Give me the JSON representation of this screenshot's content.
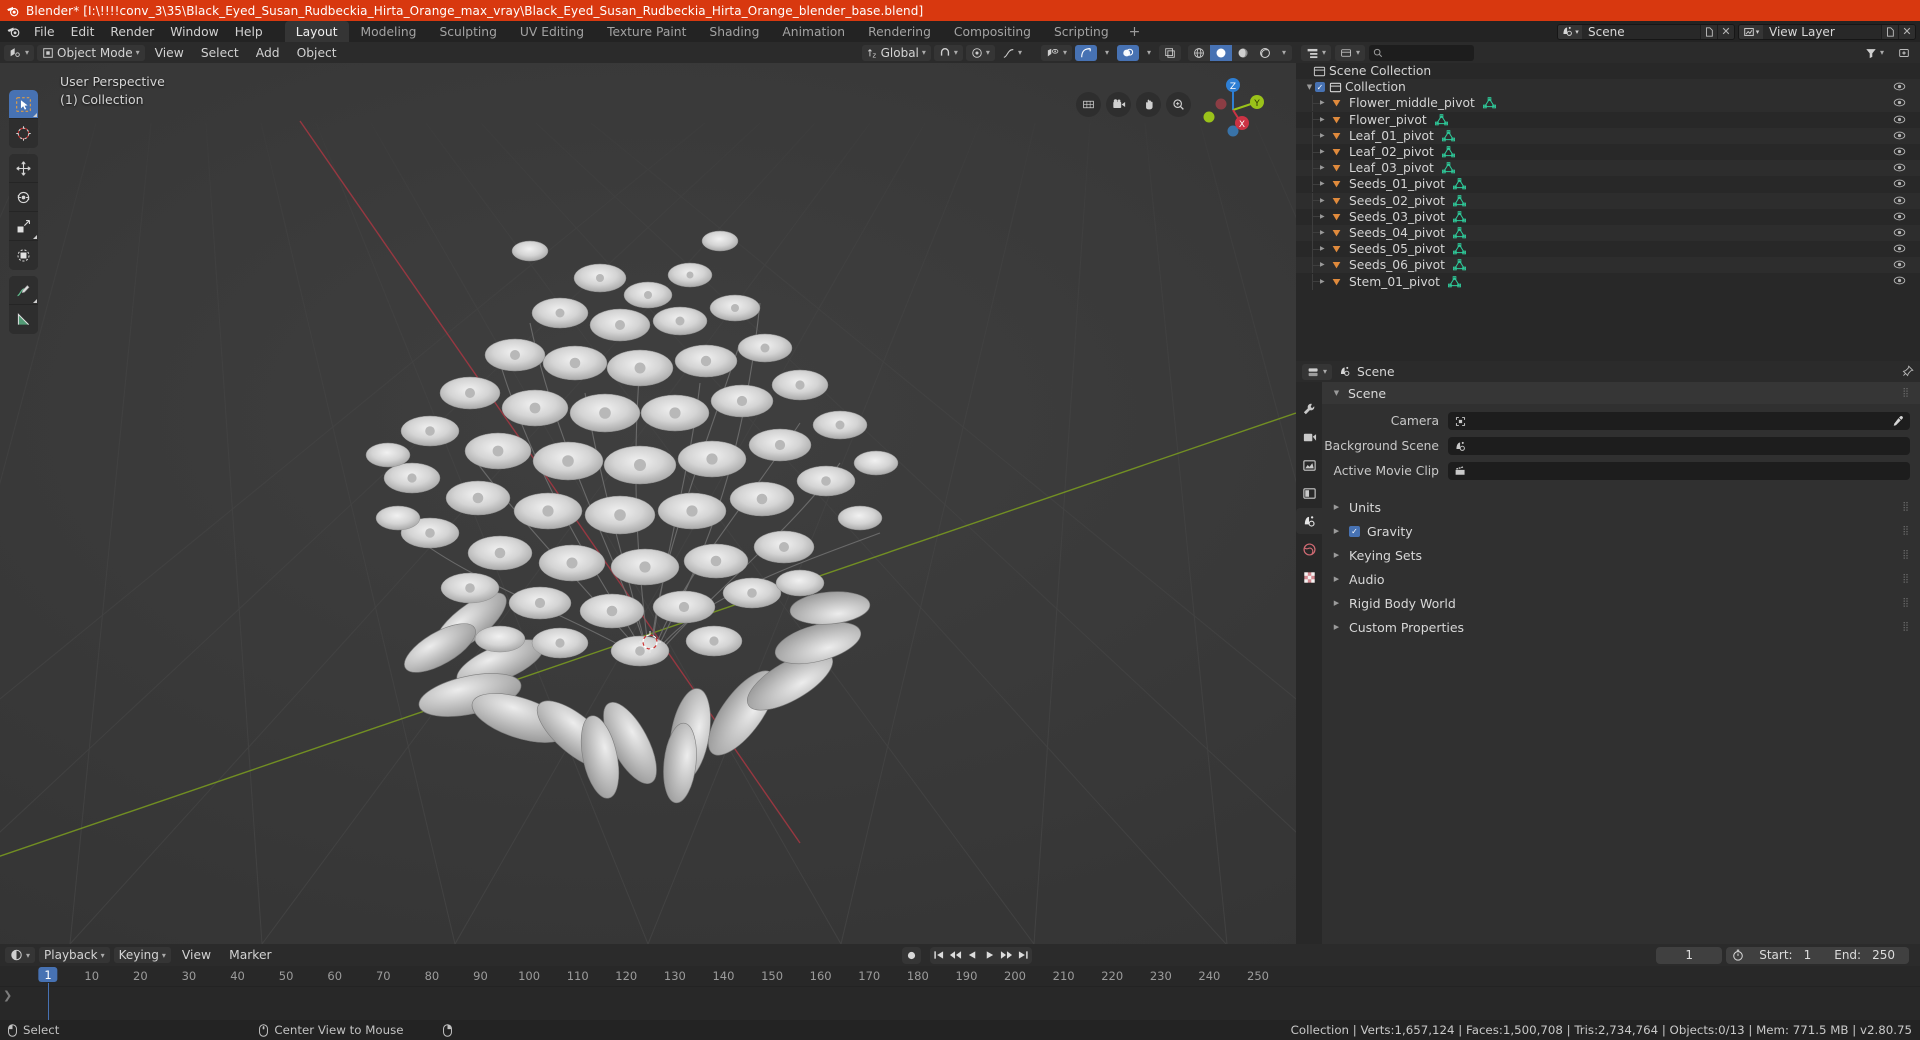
{
  "window": {
    "title": "Blender* [I:\\!!!!conv_3\\35\\Black_Eyed_Susan_Rudbeckia_Hirta_Orange_max_vray\\Black_Eyed_Susan_Rudbeckia_Hirta_Orange_blender_base.blend]"
  },
  "topbar": {
    "menus": [
      "File",
      "Edit",
      "Render",
      "Window",
      "Help"
    ],
    "workspaces": [
      {
        "label": "Layout",
        "active": true
      },
      {
        "label": "Modeling",
        "active": false
      },
      {
        "label": "Sculpting",
        "active": false
      },
      {
        "label": "UV Editing",
        "active": false
      },
      {
        "label": "Texture Paint",
        "active": false
      },
      {
        "label": "Shading",
        "active": false
      },
      {
        "label": "Animation",
        "active": false
      },
      {
        "label": "Rendering",
        "active": false
      },
      {
        "label": "Compositing",
        "active": false
      },
      {
        "label": "Scripting",
        "active": false
      }
    ],
    "add_workspace_label": "+",
    "scene_name": "Scene",
    "view_layer_name": "View Layer"
  },
  "viewport": {
    "mode_label": "Object Mode",
    "menus": [
      "View",
      "Select",
      "Add",
      "Object"
    ],
    "transform_orientation": "Global",
    "overlay_perspective": "User Perspective",
    "overlay_collection": "(1) Collection",
    "gizmo_axes": [
      "Z",
      "Y",
      "X"
    ],
    "accent_select": "#4772b3",
    "axis_x_color": "#cc3344",
    "axis_y_color": "#9ac21a",
    "axis_z_color": "#2e7fd4"
  },
  "outliner": {
    "search_placeholder": "",
    "root": "Scene Collection",
    "collection": "Collection",
    "items": [
      {
        "name": "Flower_middle_pivot"
      },
      {
        "name": "Flower_pivot"
      },
      {
        "name": "Leaf_01_pivot"
      },
      {
        "name": "Leaf_02_pivot"
      },
      {
        "name": "Leaf_03_pivot"
      },
      {
        "name": "Seeds_01_pivot"
      },
      {
        "name": "Seeds_02_pivot"
      },
      {
        "name": "Seeds_03_pivot"
      },
      {
        "name": "Seeds_04_pivot"
      },
      {
        "name": "Seeds_05_pivot"
      },
      {
        "name": "Seeds_06_pivot"
      },
      {
        "name": "Stem_01_pivot"
      }
    ]
  },
  "properties": {
    "breadcrumb": "Scene",
    "panel_title": "Scene",
    "fields": [
      {
        "label": "Camera",
        "value": ""
      },
      {
        "label": "Background Scene",
        "value": ""
      },
      {
        "label": "Active Movie Clip",
        "value": ""
      }
    ],
    "sections": [
      {
        "label": "Units",
        "checkbox": false
      },
      {
        "label": "Gravity",
        "checkbox": true
      },
      {
        "label": "Keying Sets",
        "checkbox": false
      },
      {
        "label": "Audio",
        "checkbox": false
      },
      {
        "label": "Rigid Body World",
        "checkbox": false
      },
      {
        "label": "Custom Properties",
        "checkbox": false
      }
    ]
  },
  "timeline": {
    "menus": [
      "Playback",
      "Keying",
      "View",
      "Marker"
    ],
    "current_frame": "1",
    "start_label": "Start:",
    "start_value": "1",
    "end_label": "End:",
    "end_value": "250",
    "ticks": [
      "10",
      "20",
      "30",
      "40",
      "50",
      "60",
      "70",
      "80",
      "90",
      "100",
      "110",
      "120",
      "130",
      "140",
      "150",
      "160",
      "170",
      "180",
      "190",
      "200",
      "210",
      "220",
      "230",
      "240",
      "250"
    ],
    "playhead_frame": "1"
  },
  "statusbar": {
    "left_action": "Select",
    "mid_action": "Center View to Mouse",
    "stats": "Collection | Verts:1,657,124 | Faces:1,500,708 | Tris:2,734,764 | Objects:0/13 | Mem: 771.5 MB | v2.80.75"
  }
}
